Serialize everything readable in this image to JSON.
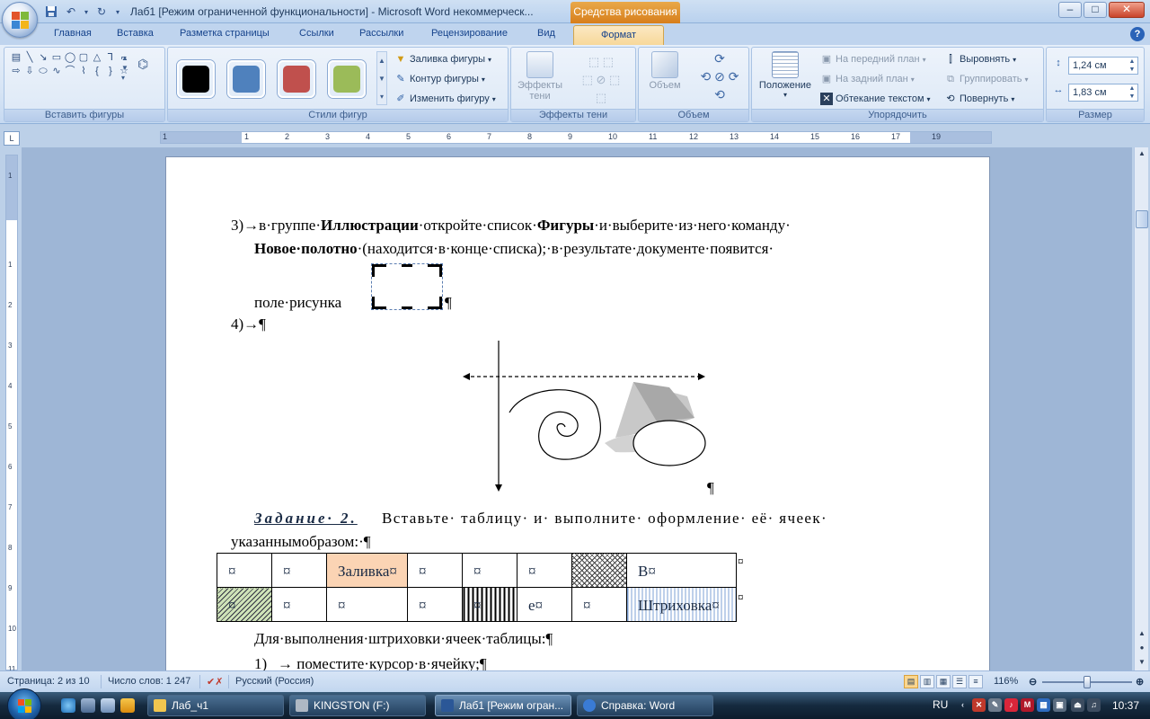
{
  "window": {
    "title": "Лаб1 [Режим ограниченной функциональности] - Microsoft Word некоммерческ...",
    "context_tab_group": "Средства рисования"
  },
  "tabs": [
    "Главная",
    "Вставка",
    "Разметка страницы",
    "Ссылки",
    "Рассылки",
    "Рецензирование",
    "Вид",
    "Формат"
  ],
  "active_tab": "Формат",
  "ribbon": {
    "insert_shapes": {
      "label": "Вставить фигуры"
    },
    "shape_styles": {
      "label": "Стили фигур",
      "swatch_colors": [
        "#000000",
        "#4f81bd",
        "#c0504d",
        "#9bbb59"
      ],
      "fill": "Заливка фигуры",
      "outline": "Контур фигуры",
      "change": "Изменить фигуру"
    },
    "shadow_effects": {
      "button": "Эффекты тени",
      "label": "Эффекты тени"
    },
    "volume": {
      "button": "Объем",
      "label": "Объем"
    },
    "arrange": {
      "label": "Упорядочить",
      "position": "Положение",
      "bring_front": "На передний план",
      "send_back": "На задний план",
      "wrap": "Обтекание текстом",
      "align": "Выровнять",
      "group": "Группировать",
      "rotate": "Повернуть"
    },
    "size": {
      "label": "Размер",
      "height": "1,24 см",
      "width": "1,83 см"
    }
  },
  "ruler": {
    "h_numbers": [
      "1",
      "1",
      "2",
      "3",
      "4",
      "5",
      "6",
      "7",
      "8",
      "9",
      "10",
      "11",
      "12",
      "13",
      "14",
      "15",
      "16",
      "17",
      "19"
    ],
    "v_numbers": [
      "1",
      "1",
      "2",
      "3",
      "4",
      "5",
      "6",
      "7",
      "8",
      "9",
      "10",
      "11"
    ]
  },
  "document": {
    "item3_num": "3)→",
    "item3_a": "в·группе·",
    "item3_b": "Иллюстрации",
    "item3_c": "·откройте·список·",
    "item3_d": "Фигуры",
    "item3_e": "·и·выберите·из·него·команду·",
    "item3_line2_b": "Новое·полотно",
    "item3_line2_rest": "·(находится·в·конце·списка);·в·результате·документе·появится·",
    "item3_line3": "поле·рисунка",
    "pilcrow": "¶",
    "item4": "4)→¶",
    "task_title": "Задание· 2.",
    "task_text": "Вставьте· таблицу· и· выполните· оформление· её· ячеек·",
    "task_line2": "указаннымобразом:·¶",
    "table": [
      [
        "¤",
        "¤",
        "Заливка¤",
        "¤",
        "¤",
        "¤",
        "",
        "В¤"
      ],
      [
        "¤",
        "¤",
        "¤",
        "¤",
        "¤",
        "е¤",
        "¤",
        "Штриховка¤"
      ]
    ],
    "end_cell_marker": "¤",
    "after_table": "Для·выполнения·штриховки·ячеек·таблицы:¶",
    "step1_num": "1)",
    "step1_text": "→  поместите·курсор·в·ячейку;¶"
  },
  "statusbar": {
    "page": "Страница: 2 из 10",
    "words": "Число слов: 1 247",
    "language": "Русский (Россия)",
    "zoom": "116%"
  },
  "taskbar": {
    "items": [
      "Лаб_ч1",
      "KINGSTON (F:)",
      "Лаб1 [Режим огран...",
      "Справка: Word"
    ],
    "lang": "RU",
    "time": "10:37"
  }
}
